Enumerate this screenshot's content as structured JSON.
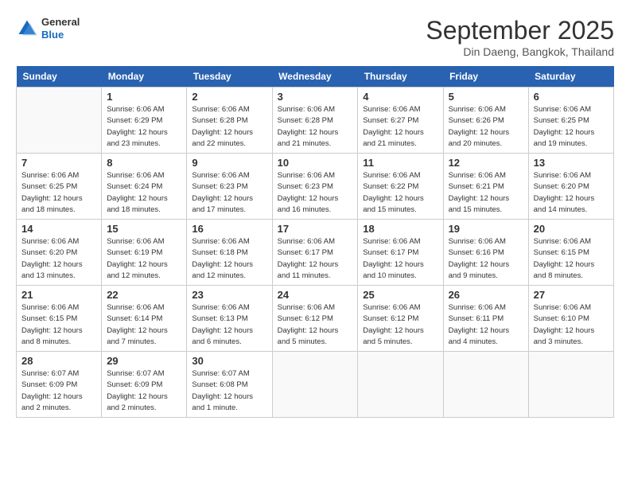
{
  "header": {
    "logo": {
      "general": "General",
      "blue": "Blue"
    },
    "title": "September 2025",
    "subtitle": "Din Daeng, Bangkok, Thailand"
  },
  "days_of_week": [
    "Sunday",
    "Monday",
    "Tuesday",
    "Wednesday",
    "Thursday",
    "Friday",
    "Saturday"
  ],
  "weeks": [
    [
      {
        "day": "",
        "info": ""
      },
      {
        "day": "1",
        "info": "Sunrise: 6:06 AM\nSunset: 6:29 PM\nDaylight: 12 hours\nand 23 minutes."
      },
      {
        "day": "2",
        "info": "Sunrise: 6:06 AM\nSunset: 6:28 PM\nDaylight: 12 hours\nand 22 minutes."
      },
      {
        "day": "3",
        "info": "Sunrise: 6:06 AM\nSunset: 6:28 PM\nDaylight: 12 hours\nand 21 minutes."
      },
      {
        "day": "4",
        "info": "Sunrise: 6:06 AM\nSunset: 6:27 PM\nDaylight: 12 hours\nand 21 minutes."
      },
      {
        "day": "5",
        "info": "Sunrise: 6:06 AM\nSunset: 6:26 PM\nDaylight: 12 hours\nand 20 minutes."
      },
      {
        "day": "6",
        "info": "Sunrise: 6:06 AM\nSunset: 6:25 PM\nDaylight: 12 hours\nand 19 minutes."
      }
    ],
    [
      {
        "day": "7",
        "info": "Sunrise: 6:06 AM\nSunset: 6:25 PM\nDaylight: 12 hours\nand 18 minutes."
      },
      {
        "day": "8",
        "info": "Sunrise: 6:06 AM\nSunset: 6:24 PM\nDaylight: 12 hours\nand 18 minutes."
      },
      {
        "day": "9",
        "info": "Sunrise: 6:06 AM\nSunset: 6:23 PM\nDaylight: 12 hours\nand 17 minutes."
      },
      {
        "day": "10",
        "info": "Sunrise: 6:06 AM\nSunset: 6:23 PM\nDaylight: 12 hours\nand 16 minutes."
      },
      {
        "day": "11",
        "info": "Sunrise: 6:06 AM\nSunset: 6:22 PM\nDaylight: 12 hours\nand 15 minutes."
      },
      {
        "day": "12",
        "info": "Sunrise: 6:06 AM\nSunset: 6:21 PM\nDaylight: 12 hours\nand 15 minutes."
      },
      {
        "day": "13",
        "info": "Sunrise: 6:06 AM\nSunset: 6:20 PM\nDaylight: 12 hours\nand 14 minutes."
      }
    ],
    [
      {
        "day": "14",
        "info": "Sunrise: 6:06 AM\nSunset: 6:20 PM\nDaylight: 12 hours\nand 13 minutes."
      },
      {
        "day": "15",
        "info": "Sunrise: 6:06 AM\nSunset: 6:19 PM\nDaylight: 12 hours\nand 12 minutes."
      },
      {
        "day": "16",
        "info": "Sunrise: 6:06 AM\nSunset: 6:18 PM\nDaylight: 12 hours\nand 12 minutes."
      },
      {
        "day": "17",
        "info": "Sunrise: 6:06 AM\nSunset: 6:17 PM\nDaylight: 12 hours\nand 11 minutes."
      },
      {
        "day": "18",
        "info": "Sunrise: 6:06 AM\nSunset: 6:17 PM\nDaylight: 12 hours\nand 10 minutes."
      },
      {
        "day": "19",
        "info": "Sunrise: 6:06 AM\nSunset: 6:16 PM\nDaylight: 12 hours\nand 9 minutes."
      },
      {
        "day": "20",
        "info": "Sunrise: 6:06 AM\nSunset: 6:15 PM\nDaylight: 12 hours\nand 8 minutes."
      }
    ],
    [
      {
        "day": "21",
        "info": "Sunrise: 6:06 AM\nSunset: 6:15 PM\nDaylight: 12 hours\nand 8 minutes."
      },
      {
        "day": "22",
        "info": "Sunrise: 6:06 AM\nSunset: 6:14 PM\nDaylight: 12 hours\nand 7 minutes."
      },
      {
        "day": "23",
        "info": "Sunrise: 6:06 AM\nSunset: 6:13 PM\nDaylight: 12 hours\nand 6 minutes."
      },
      {
        "day": "24",
        "info": "Sunrise: 6:06 AM\nSunset: 6:12 PM\nDaylight: 12 hours\nand 5 minutes."
      },
      {
        "day": "25",
        "info": "Sunrise: 6:06 AM\nSunset: 6:12 PM\nDaylight: 12 hours\nand 5 minutes."
      },
      {
        "day": "26",
        "info": "Sunrise: 6:06 AM\nSunset: 6:11 PM\nDaylight: 12 hours\nand 4 minutes."
      },
      {
        "day": "27",
        "info": "Sunrise: 6:06 AM\nSunset: 6:10 PM\nDaylight: 12 hours\nand 3 minutes."
      }
    ],
    [
      {
        "day": "28",
        "info": "Sunrise: 6:07 AM\nSunset: 6:09 PM\nDaylight: 12 hours\nand 2 minutes."
      },
      {
        "day": "29",
        "info": "Sunrise: 6:07 AM\nSunset: 6:09 PM\nDaylight: 12 hours\nand 2 minutes."
      },
      {
        "day": "30",
        "info": "Sunrise: 6:07 AM\nSunset: 6:08 PM\nDaylight: 12 hours\nand 1 minute."
      },
      {
        "day": "",
        "info": ""
      },
      {
        "day": "",
        "info": ""
      },
      {
        "day": "",
        "info": ""
      },
      {
        "day": "",
        "info": ""
      }
    ]
  ]
}
